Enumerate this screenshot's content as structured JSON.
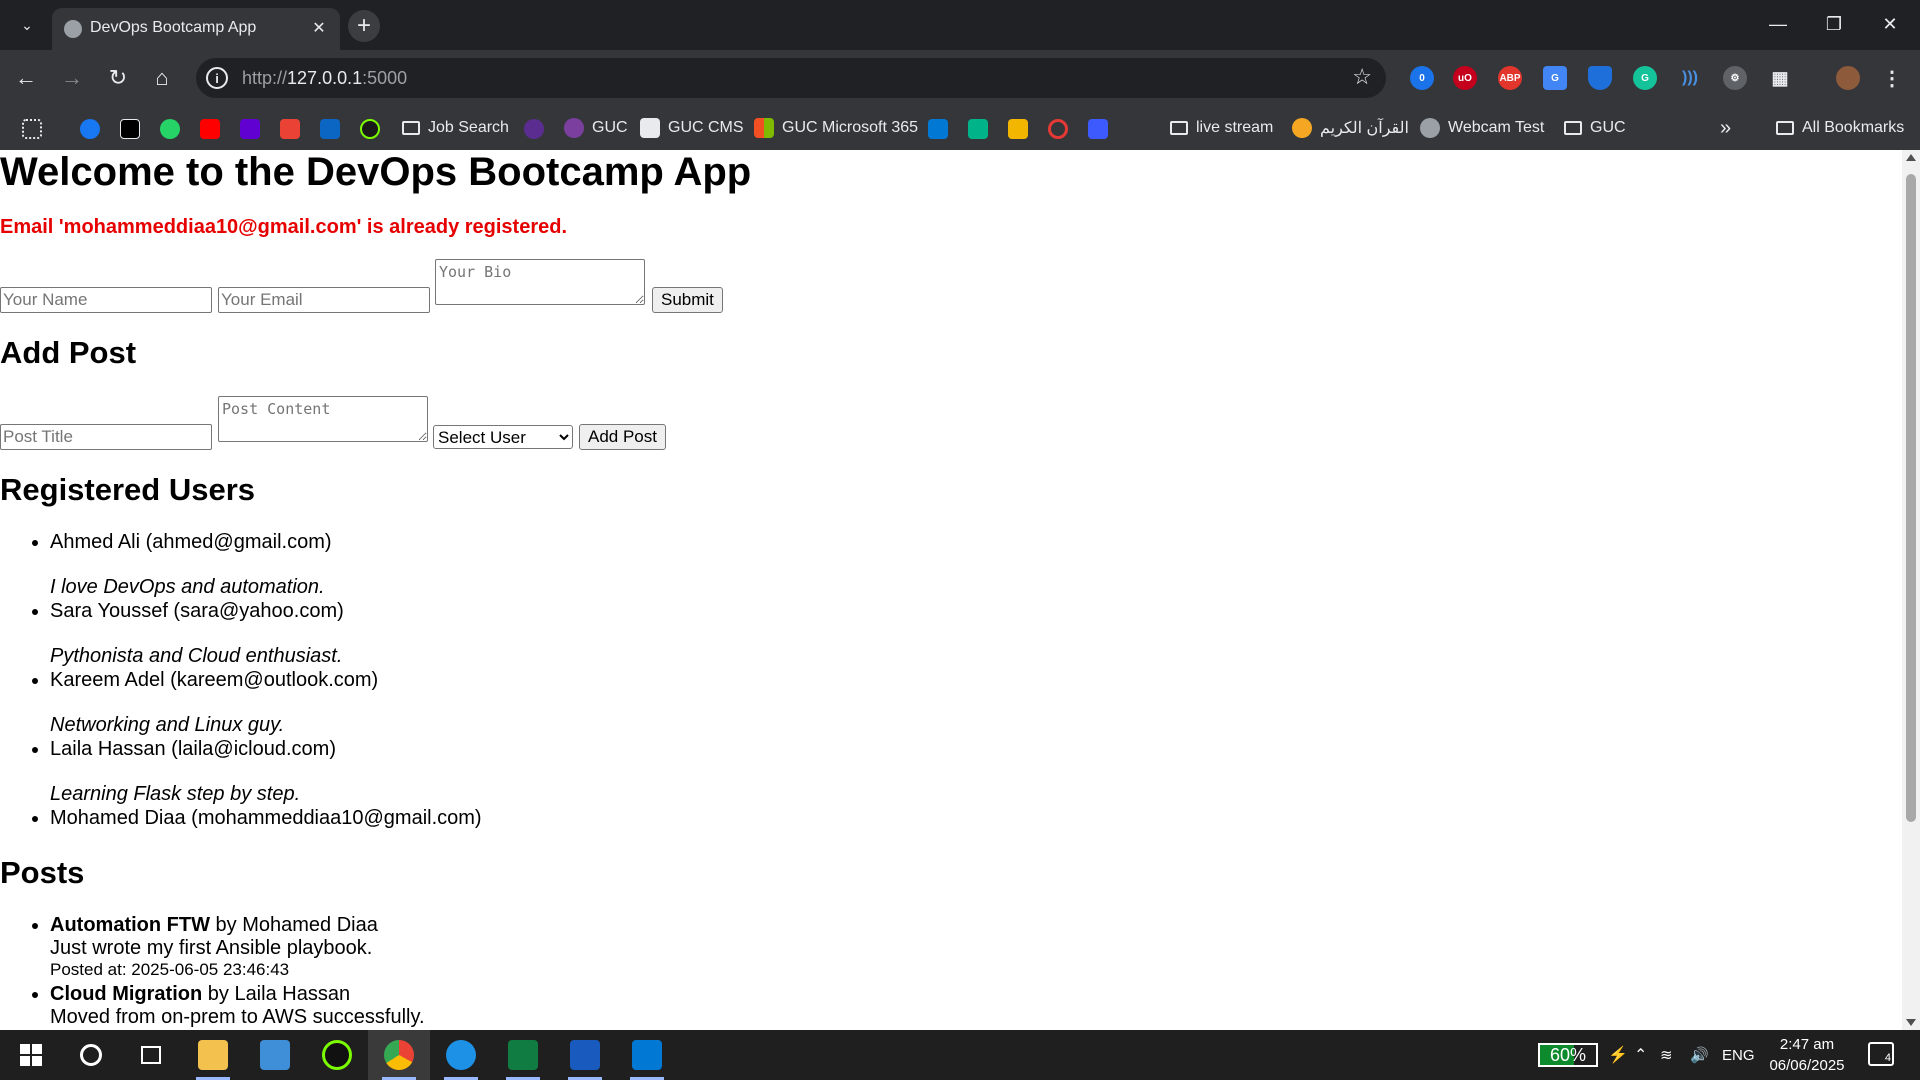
{
  "browser": {
    "tab_title": "DevOps Bootcamp App",
    "url_scheme": "http://",
    "url_host": "127.0.0.1",
    "url_port": ":5000",
    "profile_badge": "0",
    "bookmarks": [
      {
        "label": "Job Search",
        "kind": "folder"
      },
      {
        "label": "GUC",
        "kind": "link"
      },
      {
        "label": "GUC CMS",
        "kind": "link"
      },
      {
        "label": "GUC Microsoft 365",
        "kind": "link"
      },
      {
        "label": "live stream",
        "kind": "folder"
      },
      {
        "label": "القرآن الكريم",
        "kind": "link"
      },
      {
        "label": "Webcam Test",
        "kind": "link"
      },
      {
        "label": "GUC",
        "kind": "folder"
      }
    ],
    "all_bookmarks_label": "All Bookmarks",
    "overflow_label": "»"
  },
  "page": {
    "heading": "Welcome to the DevOps Bootcamp App",
    "flash_message": "Email 'mohammeddiaa10@gmail.com' is already registered.",
    "register_form": {
      "name_placeholder": "Your Name",
      "email_placeholder": "Your Email",
      "bio_placeholder": "Your Bio",
      "submit_label": "Submit"
    },
    "add_post": {
      "heading": "Add Post",
      "title_placeholder": "Post Title",
      "content_placeholder": "Post Content",
      "select_value": "Select User",
      "button_label": "Add Post"
    },
    "users": {
      "heading": "Registered Users",
      "items": [
        {
          "text": "Ahmed Ali (ahmed@gmail.com)",
          "bio": "I love DevOps and automation."
        },
        {
          "text": "Sara Youssef (sara@yahoo.com)",
          "bio": "Pythonista and Cloud enthusiast."
        },
        {
          "text": "Kareem Adel (kareem@outlook.com)",
          "bio": "Networking and Linux guy."
        },
        {
          "text": "Laila Hassan (laila@icloud.com)",
          "bio": "Learning Flask step by step."
        },
        {
          "text": "Mohamed Diaa (mohammeddiaa10@gmail.com)",
          "bio": ""
        }
      ]
    },
    "posts": {
      "heading": "Posts",
      "items": [
        {
          "title": "Automation FTW",
          "author": " by Mohamed Diaa",
          "content": "Just wrote my first Ansible playbook.",
          "date": "Posted at: 2025-06-05 23:46:43"
        },
        {
          "title": "Cloud Migration",
          "author": " by Laila Hassan",
          "content": "Moved from on-prem to AWS successfully.",
          "date": ""
        }
      ]
    }
  },
  "taskbar": {
    "battery_percent_label": "60%",
    "battery_level": 0.6,
    "language": "ENG",
    "time": "2:47 am",
    "date": "06/06/2025",
    "notifications": "4"
  }
}
